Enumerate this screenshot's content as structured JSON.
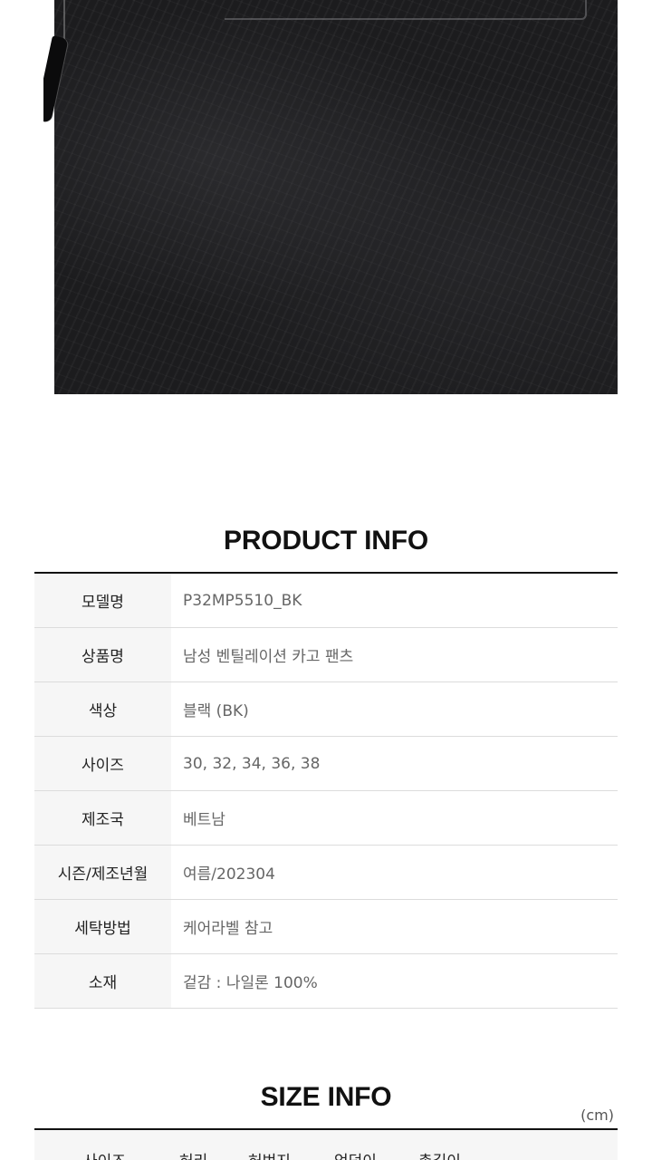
{
  "product_info": {
    "title": "PRODUCT INFO",
    "rows": [
      {
        "label": "모델명",
        "value": "P32MP5510_BK"
      },
      {
        "label": "상품명",
        "value": "남성 벤틸레이션 카고 팬츠"
      },
      {
        "label": "색상",
        "value": "블랙 (BK)"
      },
      {
        "label": "사이즈",
        "value": "30, 32, 34, 36, 38"
      },
      {
        "label": "제조국",
        "value": "베트남"
      },
      {
        "label": "시즌/제조년월",
        "value": "여름/202304"
      },
      {
        "label": "세탁방법",
        "value": "케어라벨 참고"
      },
      {
        "label": "소재",
        "value": "겉감 : 나일론 100%"
      }
    ]
  },
  "size_info": {
    "title": "SIZE INFO",
    "unit": "(cm)",
    "headers": [
      "사이즈",
      "허리",
      "허벅지",
      "엉덩이",
      "총길이"
    ]
  }
}
